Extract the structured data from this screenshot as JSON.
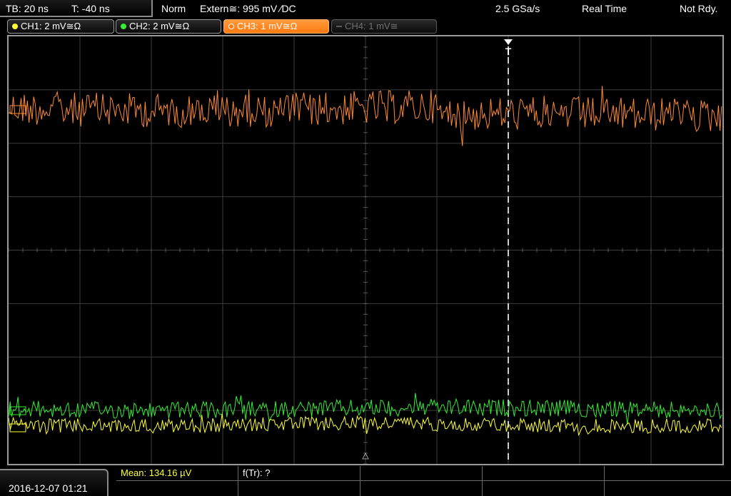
{
  "topbar": {
    "timebase": "TB: 20 ns",
    "trigger_time": "T: -40 ns",
    "trigger_mode": "Norm",
    "trigger_source": "Extern≅: 995 mV ∕DC",
    "sample_rate": "2.5 GSa/s",
    "acq_mode": "Real Time",
    "status": "Not Rdy."
  },
  "channels": [
    {
      "label": "CH1: 2 mV≅Ω",
      "color": "#ffff33",
      "active": true
    },
    {
      "label": "CH2: 2 mV≅Ω",
      "color": "#33ee33",
      "active": true
    },
    {
      "label": "CH3: 1 mV≅Ω",
      "color": "#ff8a30",
      "active": true,
      "selected": true
    },
    {
      "label": "CH4: 1 mV≅",
      "color": "#707070",
      "active": false
    }
  ],
  "trigger_marker": "T",
  "bottom": {
    "datetime": "2016-12-07 01:21",
    "mean_label": "Mean: 134.16 µV",
    "ftr_label": "f(Tr): ?"
  },
  "colors": {
    "ch1": "#ffff33",
    "ch2": "#33ee33",
    "ch3": "#ff8a30",
    "grid": "#4a4a4a",
    "frame": "#9a9a9a"
  }
}
